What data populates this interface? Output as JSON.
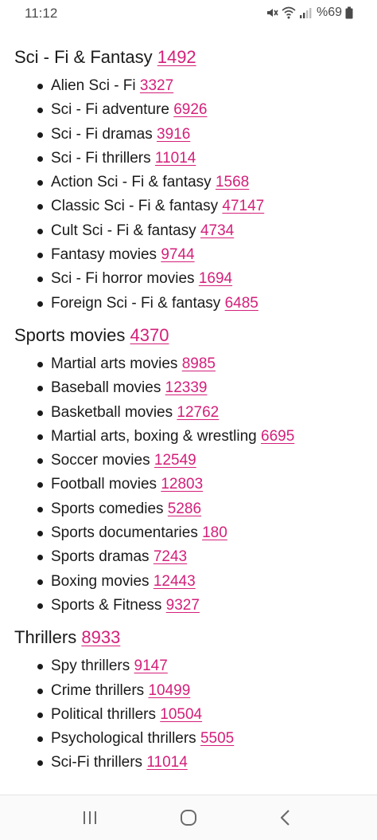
{
  "status": {
    "time": "11:12",
    "battery": "%69",
    "icons": [
      "mute-icon",
      "wifi-icon",
      "signal-icon",
      "battery-icon"
    ]
  },
  "colors": {
    "link": "#d4207a",
    "text": "#1a1a1a"
  },
  "sections": [
    {
      "title": "Sci - Fi & Fantasy",
      "count": "1492",
      "items": [
        {
          "label": "Alien Sci - Fi",
          "code": "3327"
        },
        {
          "label": "Sci - Fi adventure",
          "code": "6926"
        },
        {
          "label": "Sci - Fi dramas",
          "code": "3916"
        },
        {
          "label": "Sci - Fi thrillers",
          "code": "11014"
        },
        {
          "label": "Action Sci - Fi & fantasy",
          "code": "1568"
        },
        {
          "label": "Classic Sci - Fi & fantasy",
          "code": "47147"
        },
        {
          "label": "Cult Sci - Fi & fantasy",
          "code": "4734"
        },
        {
          "label": "Fantasy movies",
          "code": "9744"
        },
        {
          "label": "Sci - Fi horror movies",
          "code": "1694"
        },
        {
          "label": "Foreign Sci - Fi & fantasy",
          "code": "6485"
        }
      ]
    },
    {
      "title": "Sports movies",
      "count": "4370",
      "items": [
        {
          "label": "Martial arts movies",
          "code": "8985"
        },
        {
          "label": "Baseball movies",
          "code": "12339"
        },
        {
          "label": "Basketball movies",
          "code": "12762"
        },
        {
          "label": "Martial arts, boxing & wrestling",
          "code": "6695"
        },
        {
          "label": "Soccer movies",
          "code": "12549"
        },
        {
          "label": "Football movies",
          "code": "12803"
        },
        {
          "label": "Sports comedies",
          "code": "5286"
        },
        {
          "label": "Sports documentaries",
          "code": "180"
        },
        {
          "label": "Sports dramas",
          "code": "7243"
        },
        {
          "label": "Boxing movies",
          "code": "12443"
        },
        {
          "label": "Sports & Fitness",
          "code": "9327"
        }
      ]
    },
    {
      "title": "Thrillers",
      "count": "8933",
      "items": [
        {
          "label": "Spy thrillers",
          "code": "9147"
        },
        {
          "label": "Crime thrillers",
          "code": "10499"
        },
        {
          "label": "Political thrillers",
          "code": "10504"
        },
        {
          "label": "Psychological thrillers",
          "code": "5505"
        },
        {
          "label": "Sci-Fi thrillers",
          "code": "11014"
        }
      ]
    }
  ],
  "nav": {
    "buttons": [
      "recent-apps",
      "home",
      "back"
    ]
  }
}
